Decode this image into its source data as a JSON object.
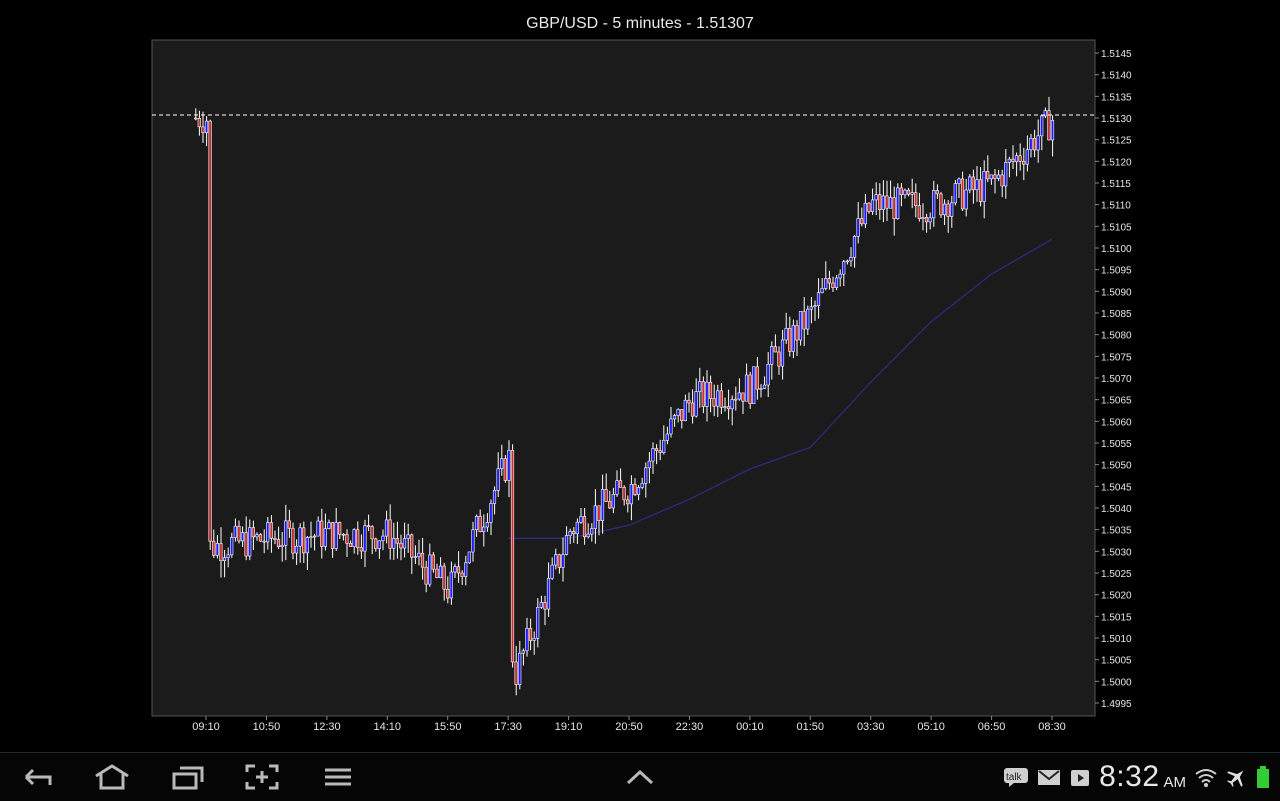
{
  "chart_title": "GBP/USD - 5 minutes - 1.51307",
  "colors": {
    "background": "#000000",
    "plot_background": "#1b1b1b",
    "candle_up": "#1c1cff",
    "candle_down": "#c43030",
    "wick": "#ffffff",
    "moving_average": "#2b2b80",
    "current_price_line": "#ffffff"
  },
  "chart_data": {
    "type": "candlestick",
    "title": "GBP/USD - 5 minutes - 1.51307",
    "current_price": 1.51307,
    "ylim": [
      1.4992,
      1.5148
    ],
    "y_ticks": [
      "1.4995",
      "1.5000",
      "1.5005",
      "1.5010",
      "1.5015",
      "1.5020",
      "1.5025",
      "1.5030",
      "1.5035",
      "1.5040",
      "1.5045",
      "1.5050",
      "1.5055",
      "1.5060",
      "1.5065",
      "1.5070",
      "1.5075",
      "1.5080",
      "1.5085",
      "1.5090",
      "1.5095",
      "1.5100",
      "1.5105",
      "1.5110",
      "1.5115",
      "1.5120",
      "1.5125",
      "1.5130",
      "1.5135",
      "1.5140",
      "1.5145"
    ],
    "x_ticks": [
      "09:10",
      "10:50",
      "12:30",
      "14:10",
      "15:50",
      "17:30",
      "19:10",
      "20:50",
      "22:30",
      "00:10",
      "01:50",
      "03:30",
      "05:10",
      "06:50",
      "08:30"
    ],
    "price_path": [
      {
        "t": "09:10",
        "price": 1.5031
      },
      {
        "t": "10:50",
        "price": 1.5033
      },
      {
        "t": "12:30",
        "price": 1.5034
      },
      {
        "t": "14:10",
        "price": 1.5034
      },
      {
        "t": "15:50",
        "price": 1.5021
      },
      {
        "t": "17:30",
        "price": 1.5052
      },
      {
        "t": "17:35",
        "price": 1.5
      },
      {
        "t": "19:10",
        "price": 1.5035
      },
      {
        "t": "20:50",
        "price": 1.5045
      },
      {
        "t": "22:30",
        "price": 1.5065
      },
      {
        "t": "00:10",
        "price": 1.5068
      },
      {
        "t": "01:50",
        "price": 1.5085
      },
      {
        "t": "03:30",
        "price": 1.511
      },
      {
        "t": "05:10",
        "price": 1.511
      },
      {
        "t": "06:50",
        "price": 1.5115
      },
      {
        "t": "08:30",
        "price": 1.513
      }
    ],
    "moving_average": [
      {
        "t": "17:30",
        "value": 1.5033
      },
      {
        "t": "19:10",
        "value": 1.5033
      },
      {
        "t": "20:50",
        "value": 1.5036
      },
      {
        "t": "22:30",
        "value": 1.5042
      },
      {
        "t": "00:10",
        "value": 1.5049
      },
      {
        "t": "01:50",
        "value": 1.5054
      },
      {
        "t": "03:30",
        "value": 1.5069
      },
      {
        "t": "05:10",
        "value": 1.5083
      },
      {
        "t": "06:50",
        "value": 1.5094
      },
      {
        "t": "08:30",
        "value": 1.5102
      }
    ]
  },
  "status_bar": {
    "clock": "8:32",
    "ampm": "AM",
    "notifications": [
      "talk-icon",
      "gmail-icon",
      "play-store-icon"
    ],
    "status_icons": [
      "wifi-icon",
      "airplane-mode-icon",
      "battery-icon"
    ]
  },
  "nav_bar": {
    "buttons": [
      "back-icon",
      "home-icon",
      "recent-apps-icon",
      "screenshot-icon",
      "menu-icon",
      "up-arrow-icon"
    ]
  }
}
